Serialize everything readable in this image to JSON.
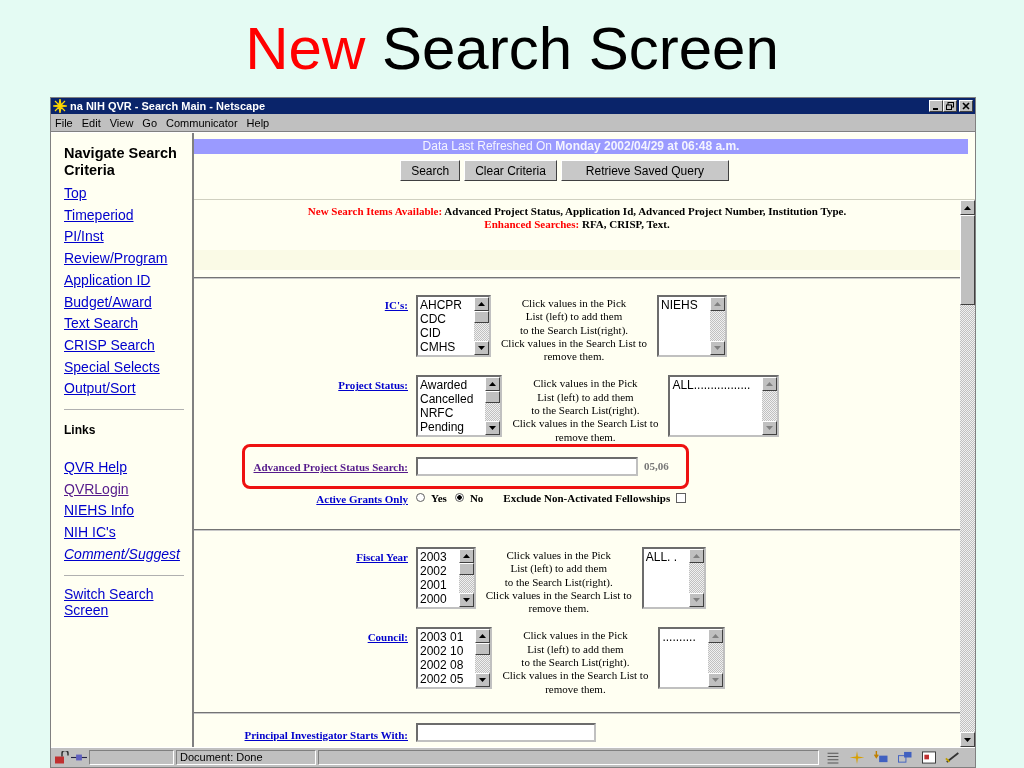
{
  "slide_title": [
    {
      "text": "New",
      "accent": true
    },
    {
      "text": "Search Screen",
      "accent": false
    }
  ],
  "window": {
    "title": "na NIH QVR - Search Main - Netscape",
    "menu": [
      "File",
      "Edit",
      "View",
      "Go",
      "Communicator",
      "Help"
    ]
  },
  "sidebar": {
    "heading": "Navigate Search Criteria",
    "nav": [
      {
        "label": "Top",
        "visited": false
      },
      {
        "label": "Timeperiod",
        "visited": false
      },
      {
        "label": "PI/Inst",
        "visited": false
      },
      {
        "label": "Review/Program",
        "visited": false
      },
      {
        "label": "Application ID",
        "visited": false
      },
      {
        "label": "Budget/Award",
        "visited": false
      },
      {
        "label": "Text Search",
        "visited": false
      },
      {
        "label": "CRISP Search",
        "visited": false
      },
      {
        "label": "Special Selects",
        "visited": false
      },
      {
        "label": "Output/Sort",
        "visited": false
      }
    ],
    "links_heading": "Links",
    "links": [
      {
        "label": "QVR Help ",
        "visited": false,
        "italic": false
      },
      {
        "label": "QVRLogin",
        "visited": true,
        "italic": false
      },
      {
        "label": "NIEHS Info",
        "visited": false,
        "italic": false
      },
      {
        "label": "NIH IC's",
        "visited": false,
        "italic": false
      },
      {
        "label": "Comment/Suggest",
        "visited": false,
        "italic": true
      }
    ],
    "switch": "Switch Search Screen"
  },
  "banner": "Data Last Refreshed On **Monday 2002/04/29 at 06:48 a.m.**",
  "buttons": [
    "Search",
    "Clear Criteria",
    "Retrieve Saved Query"
  ],
  "notices": [
    {
      "label": "New Search Items Available:",
      "text": "Advanced Project Status, Application Id, Advanced Project Number, Institution Type."
    },
    {
      "label": "Enhanced Searches:",
      "text": "RFA, CRISP, Text."
    }
  ],
  "pick_sections": [
    {
      "label": "IC's:",
      "pick": [
        "AHCPR",
        "CDC",
        "CID",
        "CMHS"
      ],
      "help": [
        "Click values in the Pick",
        "List (left) to add them",
        "to the Search List(right).",
        "Click values in the Search List to",
        "remove them."
      ],
      "search": [
        "NIEHS"
      ]
    },
    {
      "label": "Project Status:",
      "pick": [
        "Awarded",
        "Cancelled",
        "NRFC",
        "Pending"
      ],
      "help": [
        "Click values in the Pick",
        "List (left) to add them",
        "to the Search List(right).",
        "Click values in the Search List to",
        "remove them."
      ],
      "search": [
        "ALL................."
      ]
    }
  ],
  "advanced": {
    "label": "Advanced Project Status Search:",
    "hint": "05,06",
    "highlighted": true
  },
  "active_grants": {
    "label": "Active Grants Only",
    "options": [
      {
        "label": "Yes",
        "selected": false
      },
      {
        "label": "No",
        "selected": true
      }
    ],
    "exclude": {
      "label": "Exclude Non-Activated Fellowships",
      "checked": false
    }
  },
  "pick_sections_2": [
    {
      "label": "Fiscal Year",
      "pick": [
        "2003",
        "2002",
        "2001",
        "2000"
      ],
      "help": [
        "Click values in the Pick",
        "List (left) to add them",
        "to the Search List(right).",
        "Click values in the Search List to",
        "remove them."
      ],
      "search": [
        "ALL. ."
      ]
    },
    {
      "label": "Council:",
      "pick": [
        "2003 01",
        "2002 10",
        "2002 08",
        "2002 05"
      ],
      "help": [
        "Click values in the Pick",
        "List (left) to add them",
        "to the Search List(right).",
        "Click values in the Search List to",
        "remove them."
      ],
      "search": [
        ".........."
      ]
    }
  ],
  "pi_field": {
    "label": "Principal Investigator Starts With:"
  },
  "status_bar": "Document: Done"
}
